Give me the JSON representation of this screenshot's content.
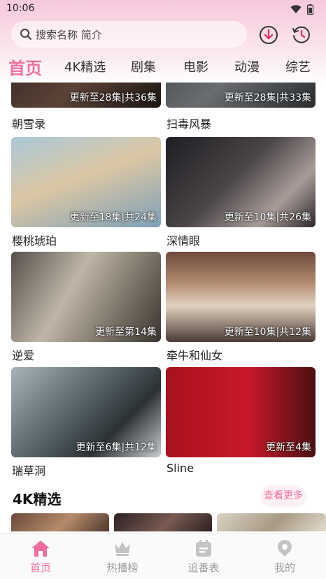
{
  "status": {
    "time": "10:06"
  },
  "search": {
    "placeholder": "搜索名称 简介"
  },
  "tabs": [
    {
      "label": "首页"
    },
    {
      "label": "4K精选"
    },
    {
      "label": "剧集"
    },
    {
      "label": "电影"
    },
    {
      "label": "动漫"
    },
    {
      "label": "综艺"
    }
  ],
  "grid": [
    {
      "title": "朝雪录",
      "badge": "更新至28集|共36集"
    },
    {
      "title": "扫毒风暴",
      "badge": "更新至28集|共33集"
    },
    {
      "title": "樱桃琥珀",
      "badge": "更新至18集|共24集"
    },
    {
      "title": "深情眼",
      "badge": "更新至10集|共26集"
    },
    {
      "title": "逆爱",
      "badge": "更新至第14集"
    },
    {
      "title": "牵牛和仙女",
      "badge": "更新至10集|共12集"
    },
    {
      "title": "瑞草洞",
      "badge": "更新至6集|共12集"
    },
    {
      "title": "Sline",
      "badge": "更新至4集"
    }
  ],
  "section": {
    "title": "4K精选",
    "more_label": "查看更多"
  },
  "bottom_nav": [
    {
      "label": "首页",
      "icon": "home-icon"
    },
    {
      "label": "热播榜",
      "icon": "crown-icon"
    },
    {
      "label": "追番表",
      "icon": "calendar-icon"
    },
    {
      "label": "我的",
      "icon": "profile-icon"
    }
  ],
  "colors": {
    "accent": "#f06fa0",
    "header_pink": "#f6c9dc"
  }
}
